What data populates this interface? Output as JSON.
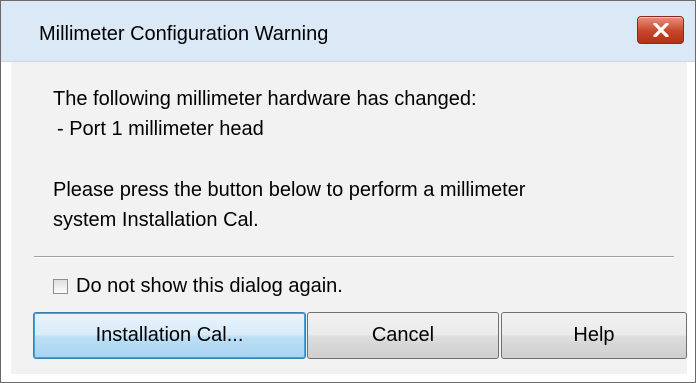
{
  "dialog": {
    "title": "Millimeter Configuration Warning",
    "close_icon": "close-x-icon",
    "message": {
      "line1": "The following millimeter hardware has changed:",
      "line2": "- Port 1 millimeter head",
      "line3": "Please press the button below to perform a millimeter",
      "line4": "system Installation Cal."
    },
    "checkbox": {
      "label": "Do not show this dialog again.",
      "checked": false
    },
    "buttons": {
      "installation_cal": "Installation Cal...",
      "cancel": "Cancel",
      "help": "Help"
    },
    "colors": {
      "titlebar": "#dbe8f6",
      "close_button": "#c8452b",
      "default_button": "#bedff5"
    }
  }
}
